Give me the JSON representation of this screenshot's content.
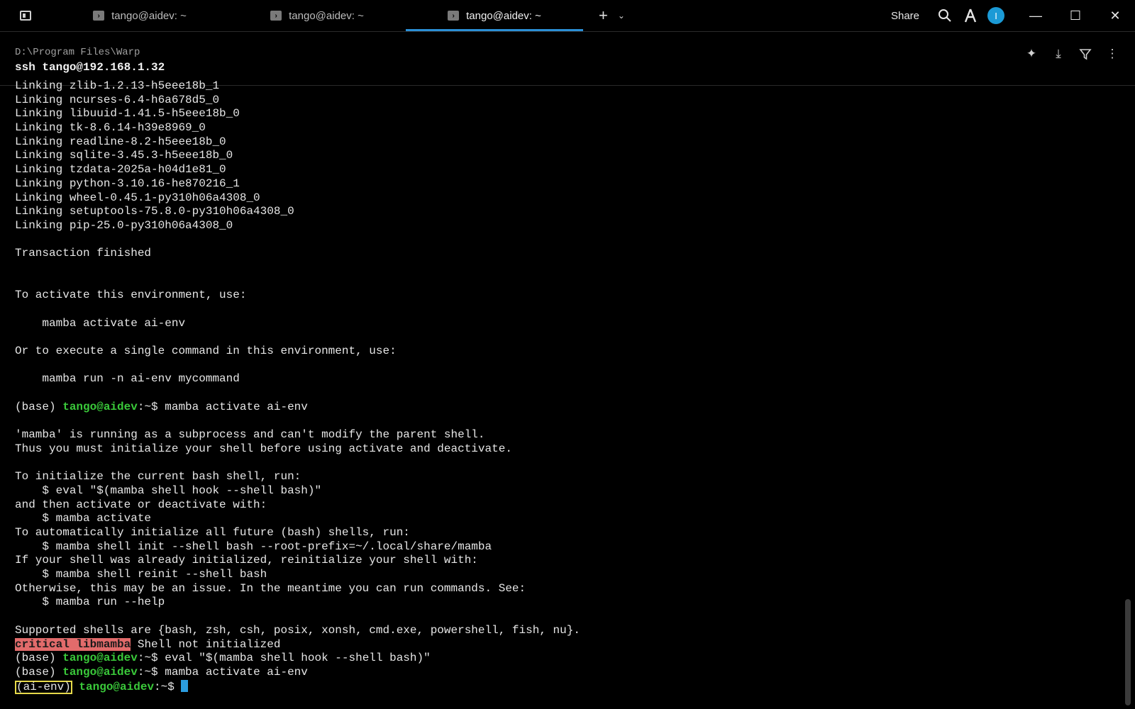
{
  "tabs": [
    {
      "title": "tango@aidev: ~",
      "active": false
    },
    {
      "title": "tango@aidev: ~",
      "active": false
    },
    {
      "title": "tango@aidev: ~",
      "active": true
    }
  ],
  "toolbar": {
    "share_label": "Share",
    "avatar_letter": "I",
    "icons": [
      "search-icon",
      "warp-ai-icon",
      "avatar",
      "minimize-icon",
      "maximize-icon",
      "close-icon"
    ]
  },
  "block": {
    "cwd": "D:\\Program Files\\Warp",
    "command": "ssh tango@192.168.1.32"
  },
  "colors": {
    "accent": "#2b8fd6",
    "prompt_green": "#3ac93a",
    "critical_bg": "#e26b6b",
    "env_badge_border": "#e6d94a",
    "cursor": "#2b9de0"
  },
  "terminal": {
    "lines": [
      "Linking zlib-1.2.13-h5eee18b_1",
      "Linking ncurses-6.4-h6a678d5_0",
      "Linking libuuid-1.41.5-h5eee18b_0",
      "Linking tk-8.6.14-h39e8969_0",
      "Linking readline-8.2-h5eee18b_0",
      "Linking sqlite-3.45.3-h5eee18b_0",
      "Linking tzdata-2025a-h04d1e81_0",
      "Linking python-3.10.16-he870216_1",
      "Linking wheel-0.45.1-py310h06a4308_0",
      "Linking setuptools-75.8.0-py310h06a4308_0",
      "Linking pip-25.0-py310h06a4308_0",
      "",
      "Transaction finished",
      "",
      "",
      "To activate this environment, use:",
      "",
      "    mamba activate ai-env",
      "",
      "Or to execute a single command in this environment, use:",
      "",
      "    mamba run -n ai-env mycommand",
      ""
    ],
    "prompt1": {
      "env": "(base) ",
      "user": "tango@aidev",
      "path": ":~$ ",
      "cmd": "mamba activate ai-env"
    },
    "lines2": [
      "",
      "'mamba' is running as a subprocess and can't modify the parent shell.",
      "Thus you must initialize your shell before using activate and deactivate.",
      "",
      "To initialize the current bash shell, run:",
      "    $ eval \"$(mamba shell hook --shell bash)\"",
      "and then activate or deactivate with:",
      "    $ mamba activate",
      "To automatically initialize all future (bash) shells, run:",
      "    $ mamba shell init --shell bash --root-prefix=~/.local/share/mamba",
      "If your shell was already initialized, reinitialize your shell with:",
      "    $ mamba shell reinit --shell bash",
      "Otherwise, this may be an issue. In the meantime you can run commands. See:",
      "    $ mamba run --help",
      "",
      "Supported shells are {bash, zsh, csh, posix, xonsh, cmd.exe, powershell, fish, nu}."
    ],
    "critical": {
      "tag": "critical libmamba",
      "message": " Shell not initialized"
    },
    "prompt2": {
      "env": "(base) ",
      "user": "tango@aidev",
      "path": ":~$ ",
      "cmd": "eval \"$(mamba shell hook --shell bash)\""
    },
    "prompt3": {
      "env": "(base) ",
      "user": "tango@aidev",
      "path": ":~$ ",
      "cmd": "mamba activate ai-env"
    },
    "prompt4": {
      "env": "(ai-env)",
      "user": "tango@aidev",
      "path": ":~$ "
    }
  }
}
